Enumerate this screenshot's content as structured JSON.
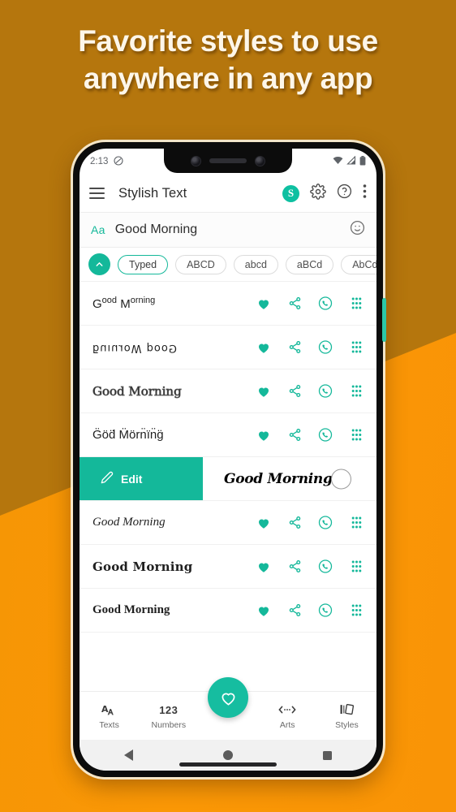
{
  "promo": {
    "headline_line1": "Favorite styles to use",
    "headline_line2": "anywhere in any app",
    "bg_top_color": "#b5760d",
    "bg_bottom_color": "#f99406",
    "text_color": "#fdf6e9"
  },
  "statusbar": {
    "time": "2:13",
    "icons": [
      "do-not-disturb-icon",
      "wifi-icon",
      "signal-icon",
      "battery-icon"
    ]
  },
  "appbar": {
    "menu_icon": "hamburger-menu-icon",
    "title": "Stylish Text",
    "coin_label": "S",
    "coin_color": "#0ec0a1",
    "settings_icon": "gear-icon",
    "help_icon": "help-circle-icon",
    "overflow_icon": "more-vertical-icon"
  },
  "input": {
    "aa_label": "Aa",
    "value": "Good Morning",
    "emoji_icon": "emoji-smiley-icon"
  },
  "chips": {
    "collapse_icon": "chevron-up-icon",
    "accent": "#14b89a",
    "items": [
      {
        "label": "Typed",
        "selected": true
      },
      {
        "label": "ABCD",
        "selected": false
      },
      {
        "label": "abcd",
        "selected": false
      },
      {
        "label": "aBCd",
        "selected": false
      },
      {
        "label": "AbCd",
        "selected": false
      }
    ]
  },
  "styles": {
    "accent": "#14b89a",
    "actions": [
      "favorite-heart-icon",
      "share-icon",
      "whatsapp-icon",
      "drag-grid-icon"
    ],
    "rows": [
      {
        "text": "Good Morning",
        "style": "superscript"
      },
      {
        "text": "ƃuıuɹoW poo⅁",
        "style": "upside-down"
      },
      {
        "text": "Good Morning",
        "style": "outline"
      },
      {
        "text": "G̈öd̈ M̈örn̈ïn̈g̈",
        "style": "diaeresis"
      },
      {
        "text": "Good Morning",
        "style": "serif-italic"
      },
      {
        "text": "Good Morning",
        "style": "fraktur-bold"
      },
      {
        "text": "Good Morning",
        "style": "bold-serif"
      }
    ],
    "swipe_row": {
      "edit_label": "Edit",
      "edit_icon": "pencil-icon",
      "text": "Good Morning",
      "style": "script",
      "touch_indicator": "touch-ring"
    }
  },
  "bottomnav": {
    "items": [
      {
        "label": "Texts",
        "icon": "texts-icon",
        "glyph": "A"
      },
      {
        "label": "Numbers",
        "icon": "numbers-icon",
        "glyph": "123"
      },
      {
        "label": "Arts",
        "icon": "arts-icon",
        "glyph": "<-->"
      },
      {
        "label": "Styles",
        "icon": "styles-icon",
        "glyph": "styles"
      }
    ],
    "fab": {
      "icon": "heart-outline-icon",
      "color": "#16bda0"
    }
  },
  "androidnav": {
    "back_icon": "back-triangle-icon",
    "home_icon": "home-circle-icon",
    "recents_icon": "recents-square-icon"
  }
}
